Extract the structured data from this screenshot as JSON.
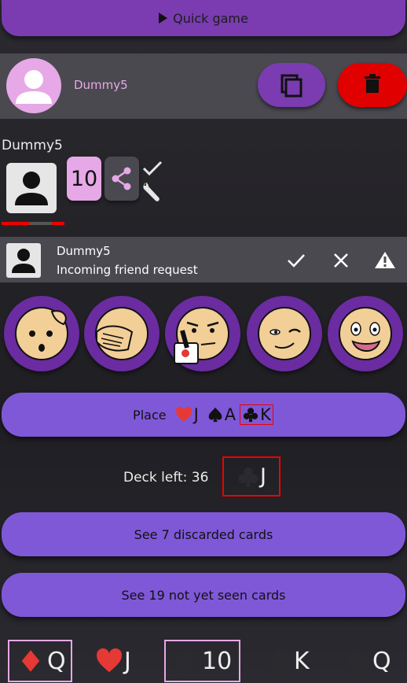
{
  "quick_game": {
    "label": "Quick game"
  },
  "user": {
    "name": "Dummy5"
  },
  "player": {
    "name": "Dummy5",
    "score": "10"
  },
  "friend_request": {
    "name": "Dummy5",
    "message": "Incoming friend request"
  },
  "emotes": [
    "confused-face",
    "facepalm-face",
    "pointing-face",
    "winking-face",
    "shocked-face"
  ],
  "place": {
    "label": "Place",
    "cards": [
      {
        "suit": "heart-icon",
        "rank": "J",
        "color": "#e53935"
      },
      {
        "suit": "spade-icon",
        "rank": "A",
        "color": "#111111"
      },
      {
        "suit": "club-icon",
        "rank": "K",
        "color": "#111111",
        "highlighted": true
      }
    ]
  },
  "deck": {
    "label": "Deck left: 36",
    "top_card": {
      "suit": "club-icon",
      "rank": "J"
    }
  },
  "discarded_button": {
    "label": "See 7 discarded cards"
  },
  "not_seen_button": {
    "label": "See 19 not yet seen cards"
  },
  "hand": [
    {
      "suit": "diamond-icon",
      "rank": "Q",
      "color": "#e53935",
      "selected": true
    },
    {
      "suit": "heart-icon",
      "rank": "J",
      "color": "#e53935",
      "selected": false
    },
    {
      "suit": "club-icon",
      "rank": "10",
      "color": "#2b2a2f",
      "selected": true
    },
    {
      "suit": "spade-icon",
      "rank": "K",
      "color": "#2b2a2f",
      "selected": false
    },
    {
      "suit": "spade-icon",
      "rank": "Q",
      "color": "#2b2a2f",
      "selected": false
    }
  ],
  "colors": {
    "accent": "#7a3cb0",
    "button": "#7f58d8",
    "danger": "#e00000",
    "pink": "#e6a8e6"
  }
}
